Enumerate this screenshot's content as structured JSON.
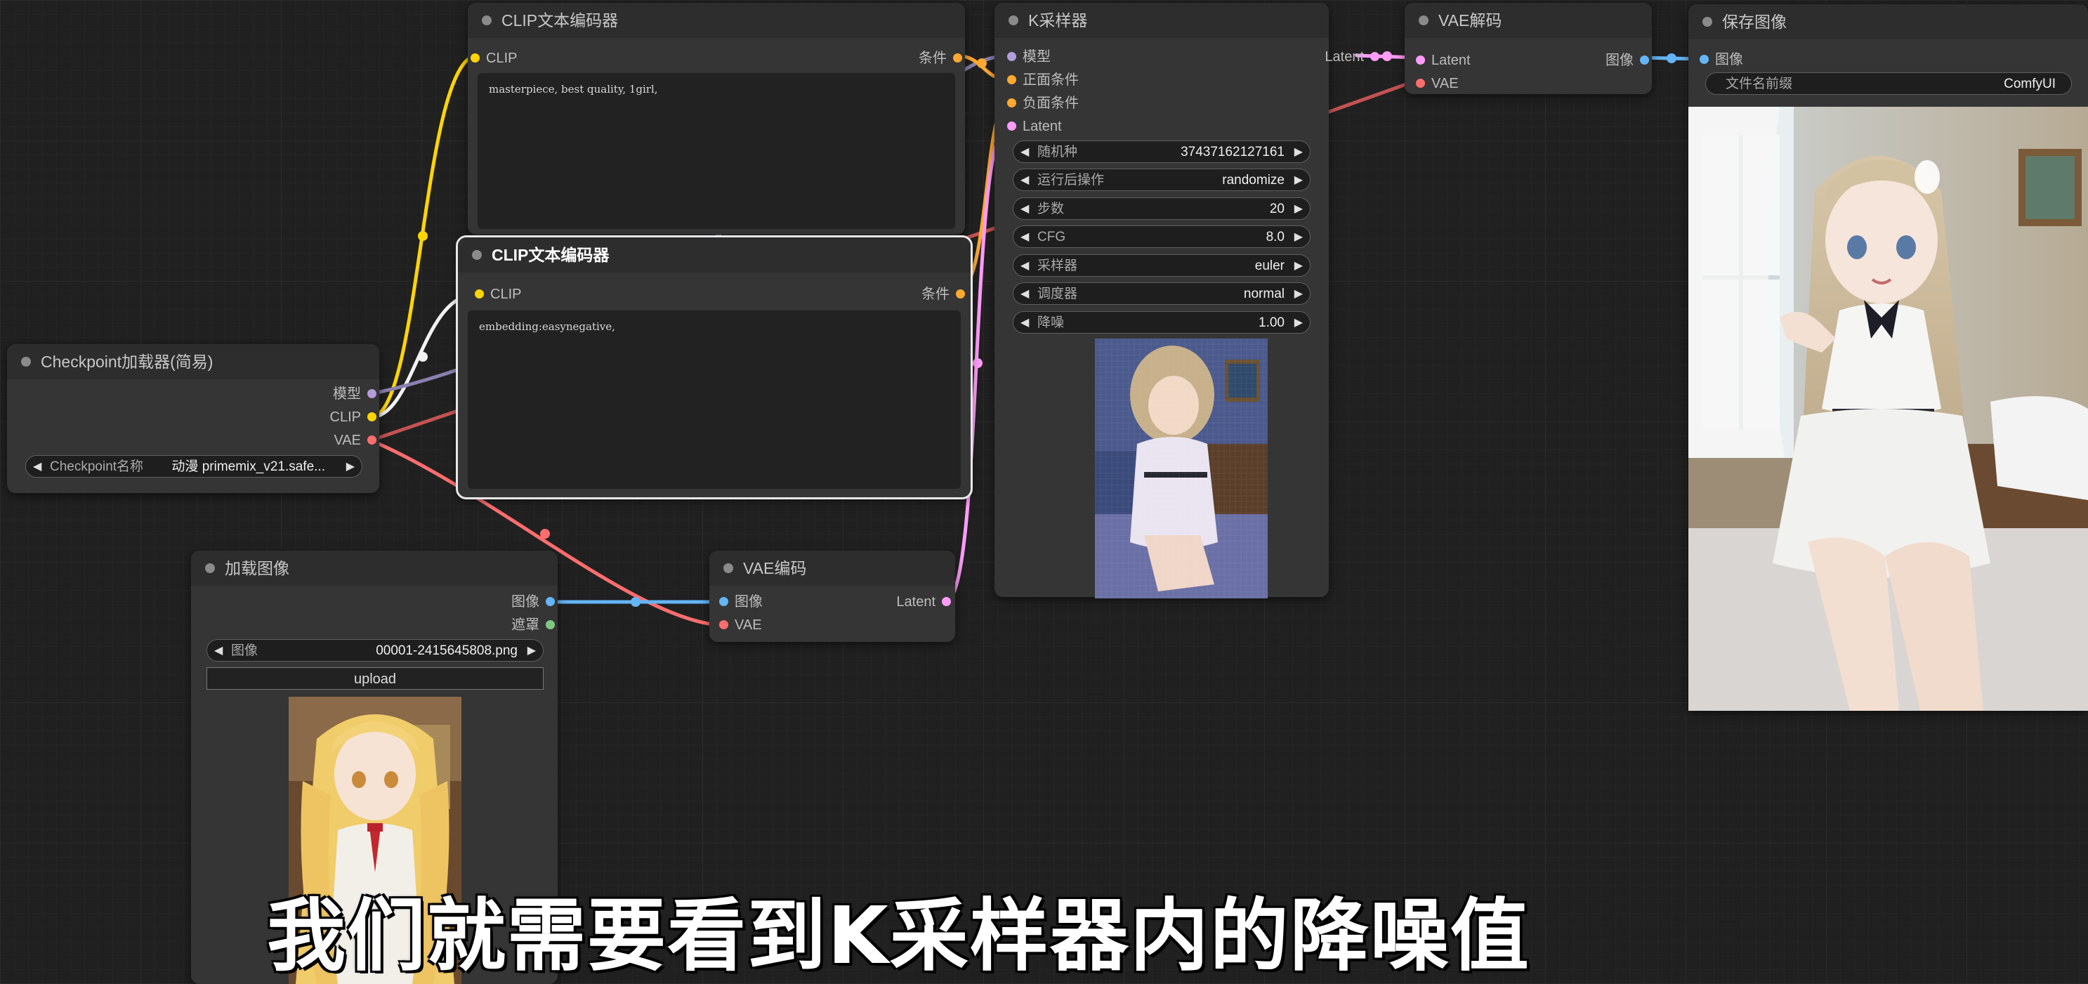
{
  "colors": {
    "model": "#b39ddb",
    "clip": "#ffd500",
    "vae": "#ff6e6e",
    "conditioning": "#ffa931",
    "latent": "#ff9cf9",
    "image": "#64b5f6",
    "mask": "#81c784",
    "node_bg": "#353535",
    "title_bg": "#2d2d2d"
  },
  "clip_encoder_1": {
    "title": "CLIP文本编码器",
    "input_clip": "CLIP",
    "output_cond": "条件",
    "prompt": "masterpiece, best quality, 1girl,"
  },
  "clip_encoder_2": {
    "title": "CLIP文本编码器",
    "input_clip": "CLIP",
    "output_cond": "条件",
    "prompt": "embedding:easynegative,"
  },
  "ksampler": {
    "title": "K采样器",
    "inputs": {
      "model": "模型",
      "positive": "正面条件",
      "negative": "负面条件",
      "latent": "Latent"
    },
    "output_latent": "Latent",
    "widgets": [
      {
        "label": "随机种",
        "value": "37437162127161"
      },
      {
        "label": "运行后操作",
        "value": "randomize"
      },
      {
        "label": "步数",
        "value": "20"
      },
      {
        "label": "CFG",
        "value": "8.0"
      },
      {
        "label": "采样器",
        "value": "euler"
      },
      {
        "label": "调度器",
        "value": "normal"
      },
      {
        "label": "降噪",
        "value": "1.00"
      }
    ]
  },
  "vae_decode": {
    "title": "VAE解码",
    "input_latent": "Latent",
    "input_vae": "VAE",
    "output_image": "图像"
  },
  "save_image": {
    "title": "保存图像",
    "input_image": "图像",
    "prefix_label": "文件名前缀",
    "prefix_value": "ComfyUI"
  },
  "checkpoint_loader": {
    "title": "Checkpoint加载器(简易)",
    "output_model": "模型",
    "output_clip": "CLIP",
    "output_vae": "VAE",
    "widget_label": "Checkpoint名称",
    "widget_value": "动漫 primemix_v21.safe..."
  },
  "load_image": {
    "title": "加载图像",
    "output_image": "图像",
    "output_mask": "遮罩",
    "widget_label": "图像",
    "widget_value": "00001-2415645808.png",
    "upload_label": "upload"
  },
  "vae_encode": {
    "title": "VAE编码",
    "input_image": "图像",
    "input_vae": "VAE",
    "output_latent": "Latent"
  },
  "caption": "我们就需要看到K采样器内的降噪值"
}
